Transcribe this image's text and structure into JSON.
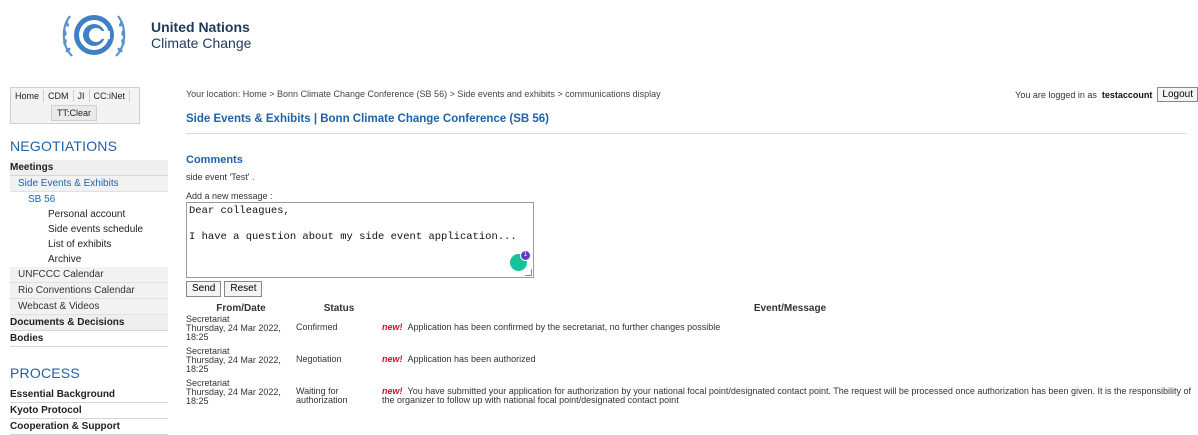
{
  "brand": {
    "line1": "United Nations",
    "line2": "Climate Change"
  },
  "sidebar": {
    "tabs": [
      "Home",
      "CDM",
      "JI",
      "CC:iNet"
    ],
    "tab_extra": "TT:Clear",
    "negotiations_title": "NEGOTIATIONS",
    "meetings": "Meetings",
    "side_events": "Side Events & Exhibits",
    "sb56": "SB 56",
    "sub_items": [
      "Personal account",
      "Side events schedule",
      "List of exhibits",
      "Archive"
    ],
    "more_items": [
      "UNFCCC Calendar",
      "Rio Conventions Calendar",
      "Webcast & Videos"
    ],
    "documents": "Documents & Decisions",
    "bodies": "Bodies",
    "process_title": "PROCESS",
    "process_items": [
      "Essential Background",
      "Kyoto Protocol",
      "Cooperation & Support"
    ]
  },
  "main": {
    "breadcrumb": "Your location: Home  >  Bonn Climate Change Conference (SB 56)  >  Side events and exhibits  >  communications display",
    "login_prefix": "You are logged in as",
    "login_user": "testaccount",
    "logout_label": "Logout",
    "page_title": "Side Events & Exhibits | Bonn Climate Change Conference (SB 56)",
    "comments_title": "Comments",
    "event_line": "side event 'Test' .",
    "add_label": "Add a new message :",
    "message_value": "Dear colleagues,\n\nI have a question about my side event application...",
    "grammarly_count": "1",
    "send_label": "Send",
    "reset_label": "Reset",
    "table": {
      "headers": [
        "From/Date",
        "Status",
        "Event/Message"
      ],
      "rows": [
        {
          "from": "Secretariat",
          "date": "Thursday, 24 Mar 2022,",
          "time": "18:25",
          "status": "Confirmed",
          "new": "new!",
          "message": "Application has been confirmed by the secretariat, no further changes possible"
        },
        {
          "from": "Secretariat",
          "date": "Thursday, 24 Mar 2022,",
          "time": "18:25",
          "status": "Negotiation",
          "new": "new!",
          "message": "Application has been authorized"
        },
        {
          "from": "Secretariat",
          "date": "Thursday, 24 Mar 2022,",
          "time": "18:25",
          "status": "Waiting for authorization",
          "new": "new!",
          "message": "You have submitted your application for authorization by your national focal point/designated contact point. The request will be processed once authorization has been given. It is the responsibility of the organizer to follow up with national focal point/designated contact point"
        }
      ]
    }
  }
}
